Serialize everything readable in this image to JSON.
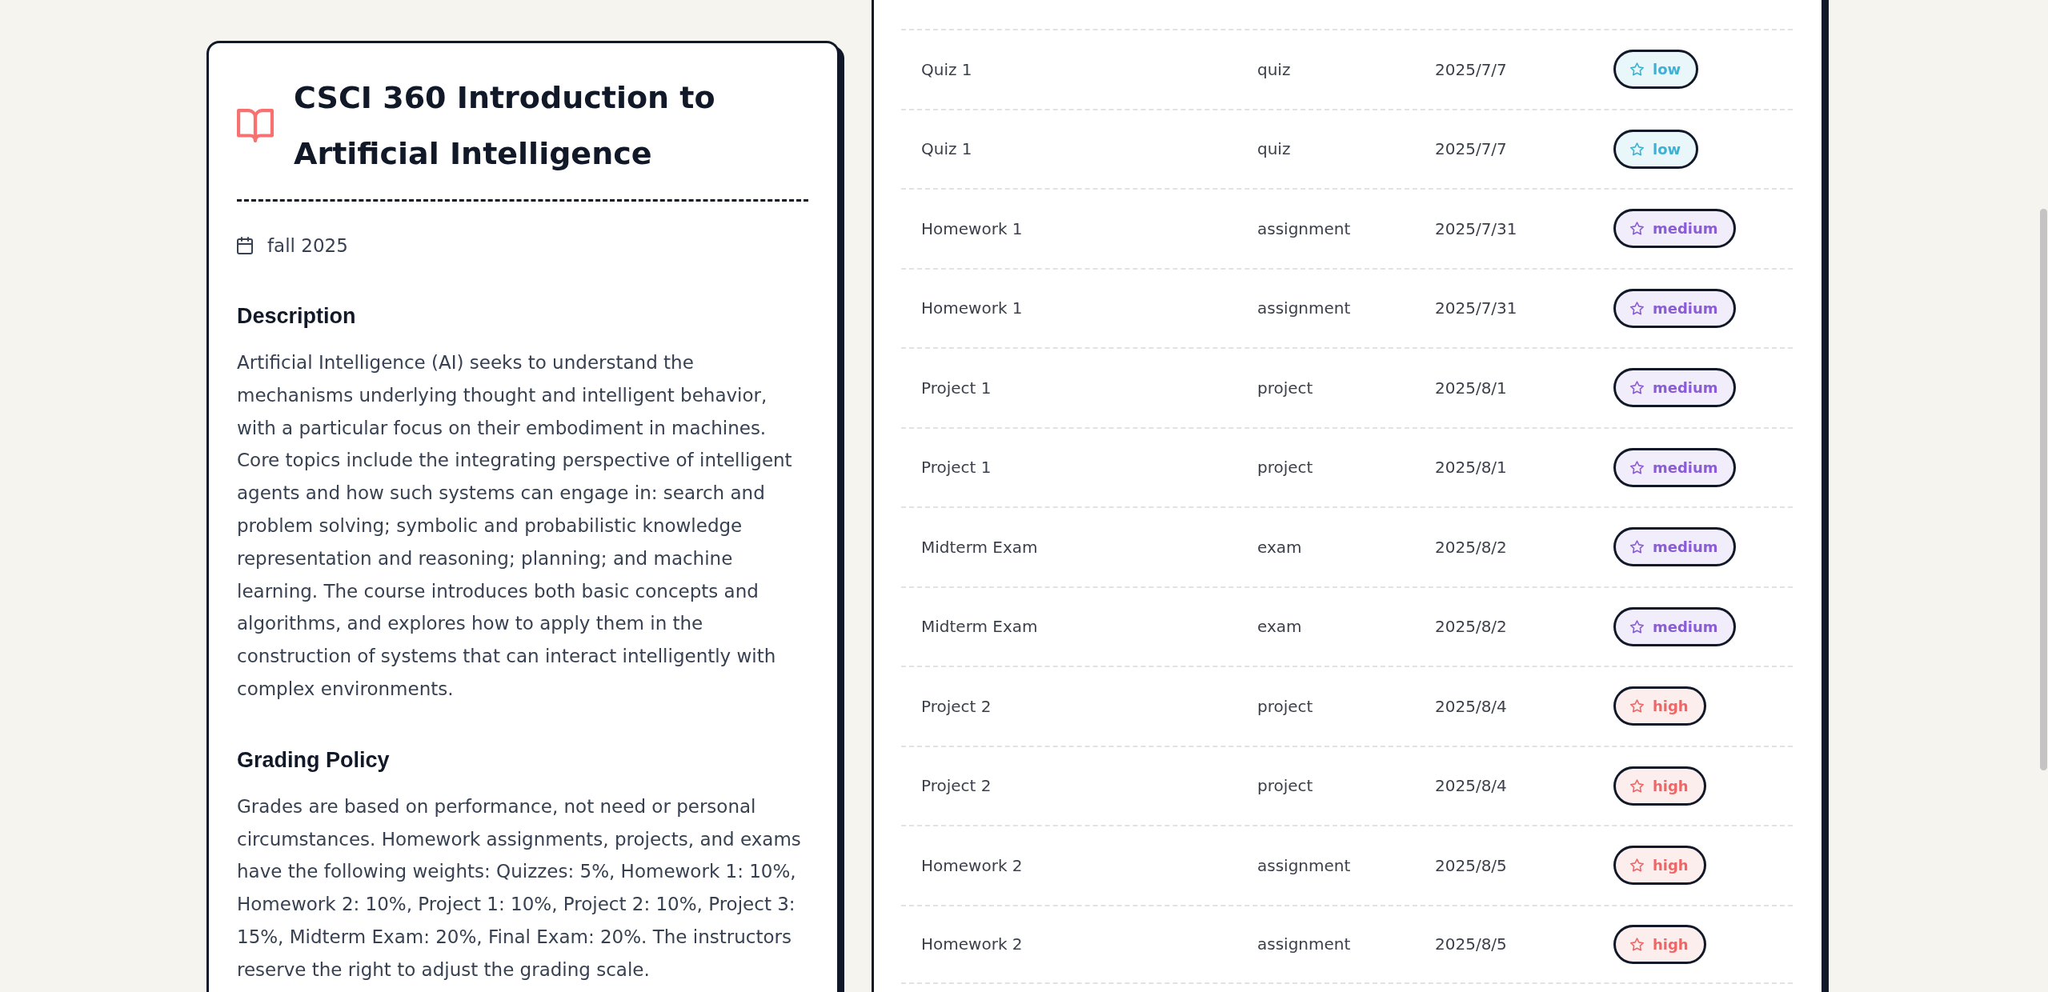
{
  "course": {
    "title": "CSCI 360 Introduction to Artificial Intelligence",
    "term": "fall 2025",
    "sections": [
      {
        "heading": "Description",
        "text": "Artificial Intelligence (AI) seeks to understand the mechanisms underlying thought and intelligent behavior, with a particular focus on their embodiment in machines. Core topics include the integrating perspective of intelligent agents and how such systems can engage in: search and problem solving; symbolic and probabilistic knowledge representation and reasoning; planning; and machine learning. The course introduces both basic concepts and algorithms, and explores how to apply them in the construction of systems that can interact intelligently with complex environments."
      },
      {
        "heading": "Grading Policy",
        "text": "Grades are based on performance, not need or personal circumstances. Homework assignments, projects, and exams have the following weights: Quizzes: 5%, Homework 1: 10%, Homework 2: 10%, Project 1: 10%, Project 2: 10%, Project 3: 15%, Midterm Exam: 20%, Final Exam: 20%. The instructors reserve the right to adjust the grading scale."
      }
    ]
  },
  "assessments": {
    "rows": [
      {
        "name": "Quiz 1",
        "type": "quiz",
        "date": "2025/7/7",
        "priority": {
          "label": "low",
          "color": "#3cb2d2"
        }
      },
      {
        "name": "Quiz 1",
        "type": "quiz",
        "date": "2025/7/7",
        "priority": {
          "label": "low",
          "color": "#3cb2d2"
        }
      },
      {
        "name": "Homework 1",
        "type": "assignment",
        "date": "2025/7/31",
        "priority": {
          "label": "medium",
          "color": "#8a5cd6"
        }
      },
      {
        "name": "Homework 1",
        "type": "assignment",
        "date": "2025/7/31",
        "priority": {
          "label": "medium",
          "color": "#8a5cd6"
        }
      },
      {
        "name": "Project 1",
        "type": "project",
        "date": "2025/8/1",
        "priority": {
          "label": "medium",
          "color": "#8a5cd6"
        }
      },
      {
        "name": "Project 1",
        "type": "project",
        "date": "2025/8/1",
        "priority": {
          "label": "medium",
          "color": "#8a5cd6"
        }
      },
      {
        "name": "Midterm Exam",
        "type": "exam",
        "date": "2025/8/2",
        "priority": {
          "label": "medium",
          "color": "#8a5cd6"
        }
      },
      {
        "name": "Midterm Exam",
        "type": "exam",
        "date": "2025/8/2",
        "priority": {
          "label": "medium",
          "color": "#8a5cd6"
        }
      },
      {
        "name": "Project 2",
        "type": "project",
        "date": "2025/8/4",
        "priority": {
          "label": "high",
          "color": "#f06666"
        }
      },
      {
        "name": "Project 2",
        "type": "project",
        "date": "2025/8/4",
        "priority": {
          "label": "high",
          "color": "#f06666"
        }
      },
      {
        "name": "Homework 2",
        "type": "assignment",
        "date": "2025/8/5",
        "priority": {
          "label": "high",
          "color": "#f06666"
        }
      },
      {
        "name": "Homework 2",
        "type": "assignment",
        "date": "2025/8/5",
        "priority": {
          "label": "high",
          "color": "#f06666"
        }
      }
    ]
  }
}
